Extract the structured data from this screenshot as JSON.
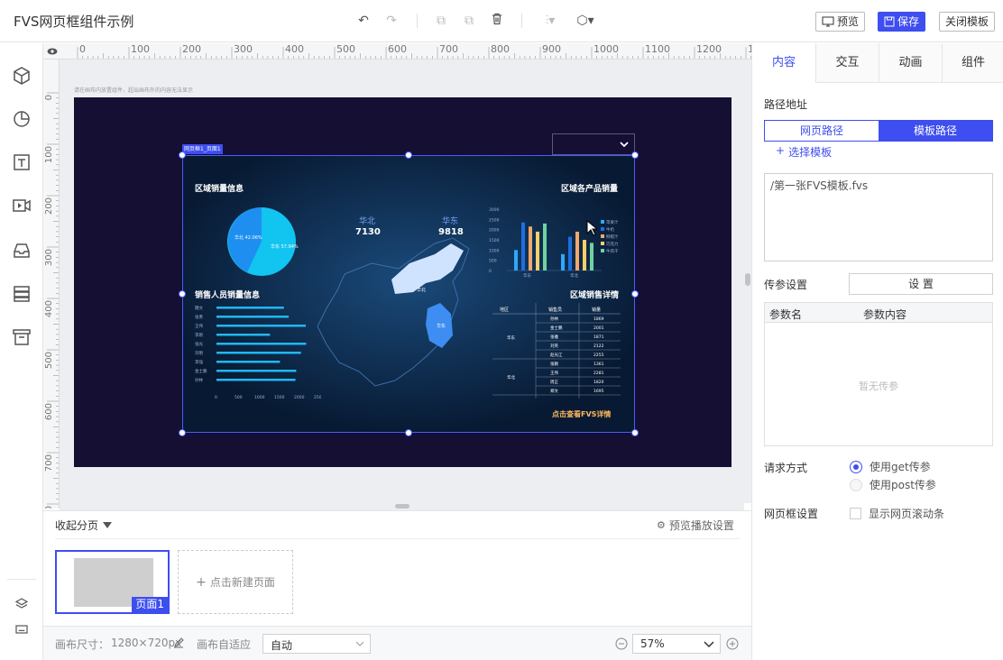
{
  "app": {
    "title": "FVS网页框组件示例"
  },
  "topbar": {
    "preview_label": "预览",
    "save_label": "保存",
    "close_label": "关闭模板"
  },
  "ruler": {
    "top_ticks": [
      "0",
      "100",
      "200",
      "300",
      "400",
      "500",
      "600",
      "700",
      "800",
      "900",
      "1000",
      "1100",
      "1200",
      "1300"
    ],
    "left_ticks": [
      "0",
      "100",
      "200",
      "300",
      "400",
      "500",
      "600",
      "700",
      "800"
    ]
  },
  "canvas": {
    "hint": "请在画布内放置组件，超出画布外的内容无法显示",
    "widget_tag": "网页框1_页面1",
    "dashboard": {
      "region_sales_title": "区域销量信息",
      "product_sales_title": "区域各产品销量",
      "staff_sales_title": "销售人员销量信息",
      "sales_detail_title": "区域销售详情",
      "kpi": [
        {
          "name": "华北",
          "value": "7130"
        },
        {
          "name": "华东",
          "value": "9818"
        }
      ],
      "pie_labels": [
        "华北 42.06%",
        "华东 57.94%"
      ],
      "map_labels": [
        "华北",
        "华东"
      ],
      "link_text": "点击查看FVS详情",
      "bar_y_ticks": [
        "3000",
        "2500",
        "2000",
        "1500",
        "1000",
        "500",
        "0"
      ],
      "bar_x_ticks": [
        "华东",
        "华北"
      ],
      "bar_legend": [
        "苹果汁",
        "牛奶",
        "柳橙汁",
        "巧克力",
        "牛肉干"
      ],
      "staff_names": [
        "魏文",
        "张勇",
        "王伟",
        "李刚",
        "张光",
        "刘明",
        "李强",
        "金士鹏",
        "孙林"
      ],
      "staff_x_ticks": [
        "0",
        "500",
        "1000",
        "1500",
        "2000",
        "2500"
      ],
      "table_headers": [
        "地区",
        "销售员",
        "销量"
      ],
      "table_regions": [
        "华东",
        "华北"
      ],
      "table_rows": [
        [
          "孙林",
          "1869"
        ],
        [
          "金士鹏",
          "2001"
        ],
        [
          "张雅",
          "1871"
        ],
        [
          "刘英",
          "2122"
        ],
        [
          "赵光江",
          "2255"
        ],
        [
          "张颖",
          "1361"
        ],
        [
          "王伟",
          "2281"
        ],
        [
          "周正",
          "1820"
        ],
        [
          "郑文",
          "1695"
        ]
      ]
    }
  },
  "pages": {
    "collapse_label": "收起分页",
    "playback_settings": "预览播放设置",
    "thumb_label": "页面1",
    "new_page_label": "点击新建页面"
  },
  "status": {
    "canvas_size_label": "画布尺寸：",
    "canvas_size_value": "1280×720px",
    "adapt_label": "画布自适应",
    "adapt_value": "自动",
    "zoom_value": "57%"
  },
  "rightpanel": {
    "tabs": [
      "内容",
      "交互",
      "动画",
      "组件"
    ],
    "path_label": "路径地址",
    "path_mode_web": "网页路径",
    "path_mode_template": "模板路径",
    "select_template": "选择模板",
    "path_value": "/第一张FVS模板.fvs",
    "param_label": "传参设置",
    "param_button": "设 置",
    "param_col_name": "参数名",
    "param_col_content": "参数内容",
    "param_empty": "暂无传参",
    "request_label": "请求方式",
    "request_get": "使用get传参",
    "request_post": "使用post传参",
    "frame_label": "网页框设置",
    "scrollbar_label": "显示网页滚动条"
  },
  "colors": {
    "accent": "#3e4ef0",
    "canvas_bg": "#140f33",
    "dashboard_bg": "#0a1a33"
  }
}
